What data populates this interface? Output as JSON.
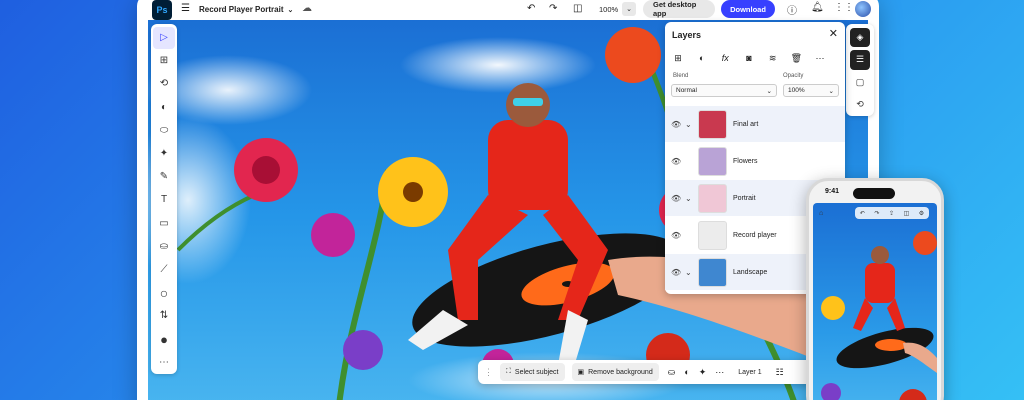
{
  "app": {
    "logo_text": "Ps",
    "document_title": "Record Player Portrait",
    "zoom": "100%",
    "get_desktop_label": "Get desktop app",
    "download_label": "Download"
  },
  "tools": [
    {
      "name": "select-tool-icon",
      "glyph": "▷"
    },
    {
      "name": "artboard-tool-icon",
      "glyph": "⊞"
    },
    {
      "name": "quick-select-icon",
      "glyph": "⟲"
    },
    {
      "name": "adjust-icon",
      "glyph": "◐"
    },
    {
      "name": "healing-icon",
      "glyph": "⬭"
    },
    {
      "name": "magic-wand-icon",
      "glyph": "✦"
    },
    {
      "name": "brush-icon",
      "glyph": "✎"
    },
    {
      "name": "text-tool-icon",
      "glyph": "T"
    },
    {
      "name": "rectangle-tool-icon",
      "glyph": "▭"
    },
    {
      "name": "fill-icon",
      "glyph": "⛀"
    },
    {
      "name": "eyedropper-icon",
      "glyph": "⟋"
    },
    {
      "name": "foreground-color-icon",
      "glyph": "○"
    },
    {
      "name": "swap-colors-icon",
      "glyph": "⇅"
    },
    {
      "name": "background-color-icon",
      "glyph": "●"
    },
    {
      "name": "more-tools-icon",
      "glyph": "⋯"
    }
  ],
  "layers_panel": {
    "title": "Layers",
    "blend_label": "Blend",
    "blend_value": "Normal",
    "opacity_label": "Opacity",
    "opacity_value": "100%",
    "layers": [
      {
        "name": "Final art",
        "expandable": true,
        "thumb": "#c9394f"
      },
      {
        "name": "Flowers",
        "expandable": false,
        "thumb": "#b9a3d6"
      },
      {
        "name": "Portrait",
        "expandable": true,
        "thumb": "#f0c7d6"
      },
      {
        "name": "Record player",
        "expandable": false,
        "thumb": "#ececec"
      },
      {
        "name": "Landscape",
        "expandable": true,
        "thumb": "#3f87d0"
      }
    ]
  },
  "action_bar": {
    "select_subject": "Select subject",
    "remove_background": "Remove background",
    "layer_name": "Layer 1"
  },
  "phone": {
    "time": "9:41"
  },
  "colors": {
    "accent": "#3740ff",
    "ps_dark": "#001e36",
    "ps_blue": "#31a8ff"
  }
}
